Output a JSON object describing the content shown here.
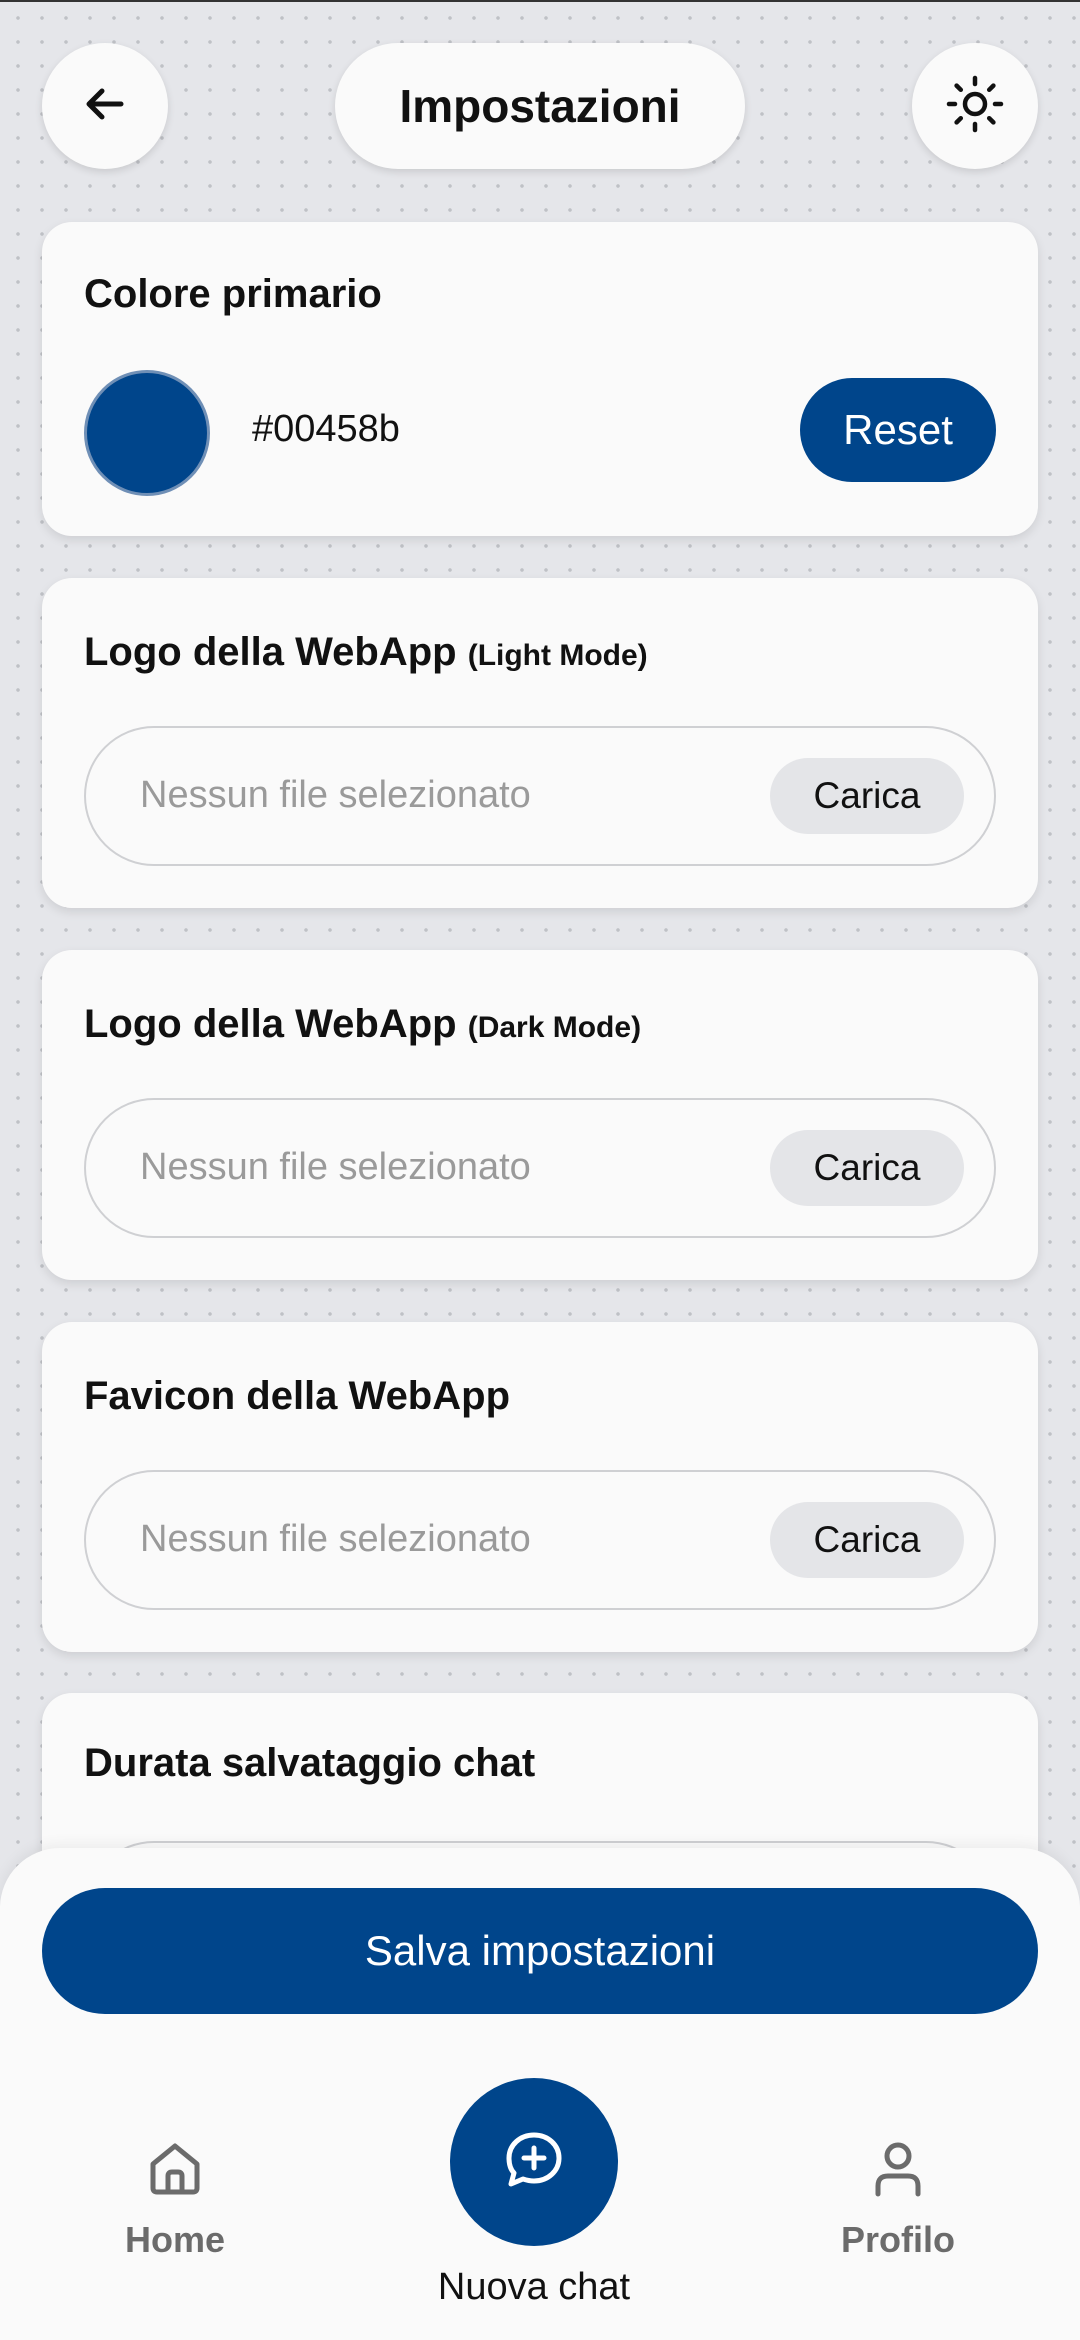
{
  "header": {
    "title": "Impostazioni",
    "back_icon": "arrow-left-icon",
    "theme_icon": "sun-icon"
  },
  "primary_color_card": {
    "title": "Colore primario",
    "hex_value": "#00458b",
    "swatch_color": "#00458b",
    "reset_label": "Reset"
  },
  "logo_light_card": {
    "title": "Logo della WebApp",
    "title_suffix": "(Light Mode)",
    "placeholder": "Nessun file selezionato",
    "upload_label": "Carica"
  },
  "logo_dark_card": {
    "title": "Logo della WebApp",
    "title_suffix": "(Dark Mode)",
    "placeholder": "Nessun file selezionato",
    "upload_label": "Carica"
  },
  "favicon_card": {
    "title": "Favicon della WebApp",
    "placeholder": "Nessun file selezionato",
    "upload_label": "Carica"
  },
  "chat_retention_card": {
    "title": "Durata salvataggio chat"
  },
  "save_button": {
    "label": "Salva impostazioni"
  },
  "bottom_nav": {
    "home_label": "Home",
    "new_chat_label": "Nuova chat",
    "profile_label": "Profilo"
  },
  "colors": {
    "accent": "#00458b",
    "background": "#e5e6ea",
    "card": "#fafafa"
  }
}
